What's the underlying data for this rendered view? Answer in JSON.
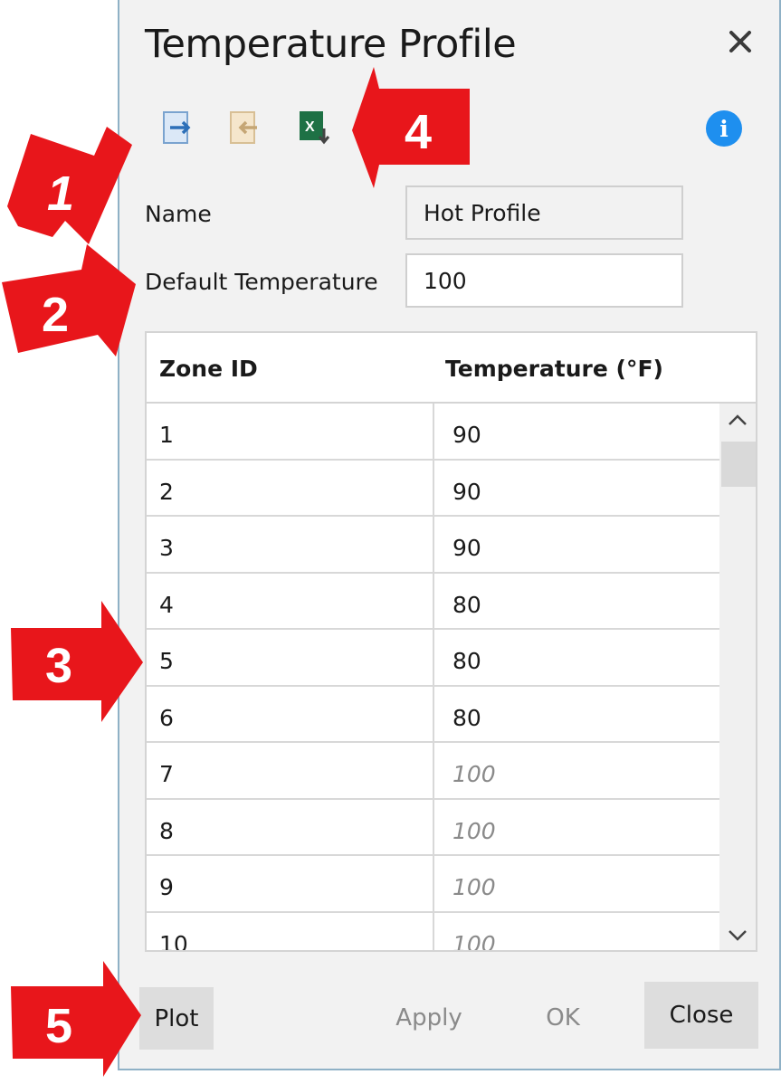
{
  "dialog": {
    "title": "Temperature Profile",
    "close_icon": "close-icon",
    "toolbar": [
      "import-icon",
      "export-icon",
      "excel-export-icon"
    ],
    "info_icon": "info-icon",
    "info_label": "i"
  },
  "form": {
    "name_label": "Name",
    "name_value": "Hot Profile",
    "default_temp_label": "Default Temperature",
    "default_temp_value": "100"
  },
  "table": {
    "headers": [
      "Zone ID",
      "Temperature (°F)"
    ],
    "rows": [
      {
        "zone": "1",
        "temp": "90",
        "is_default": false
      },
      {
        "zone": "2",
        "temp": "90",
        "is_default": false
      },
      {
        "zone": "3",
        "temp": "90",
        "is_default": false
      },
      {
        "zone": "4",
        "temp": "80",
        "is_default": false
      },
      {
        "zone": "5",
        "temp": "80",
        "is_default": false
      },
      {
        "zone": "6",
        "temp": "80",
        "is_default": false
      },
      {
        "zone": "7",
        "temp": "100",
        "is_default": true
      },
      {
        "zone": "8",
        "temp": "100",
        "is_default": true
      },
      {
        "zone": "9",
        "temp": "100",
        "is_default": true
      },
      {
        "zone": "10",
        "temp": "100",
        "is_default": true
      }
    ]
  },
  "buttons": {
    "plot": "Plot",
    "apply": "Apply",
    "ok": "OK",
    "close": "Close"
  },
  "callouts": {
    "one": "1",
    "two": "2",
    "three": "3",
    "four": "4",
    "five": "5"
  },
  "colors": {
    "callout_red": "#e8161b",
    "info_blue": "#1e8fef",
    "dialog_bg": "#f2f2f2",
    "dialog_border": "#8fb1c6",
    "default_value_gray": "#8a8a8a"
  }
}
